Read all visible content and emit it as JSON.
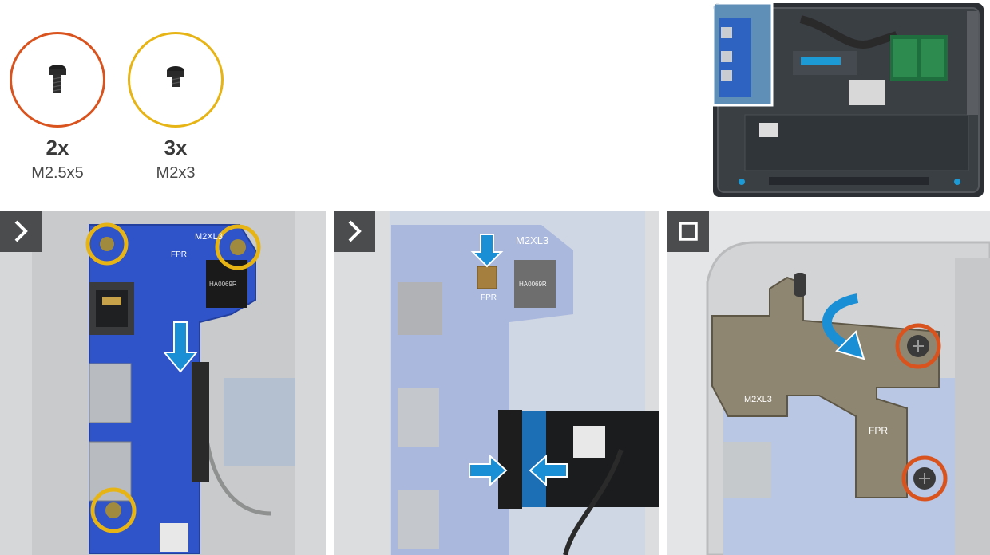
{
  "screws": [
    {
      "count": "2x",
      "size": "M2.5x5",
      "ring_color": "#d9531e"
    },
    {
      "count": "3x",
      "size": "M2x3",
      "ring_color": "#e7b416"
    }
  ],
  "step_icons": [
    "chevron-right-icon",
    "chevron-right-icon",
    "square-stop-icon"
  ],
  "board_labels": {
    "screw_label": "M2XL3",
    "fpr": "FPR",
    "ic": "HA0069R",
    "panel3_screw_label": "M2XL3"
  },
  "colors": {
    "callout_arrow": "#1a8fd6",
    "board_blue": "#2f53c8",
    "hinge": "#8f8672",
    "badge": "#4a4c4e"
  }
}
